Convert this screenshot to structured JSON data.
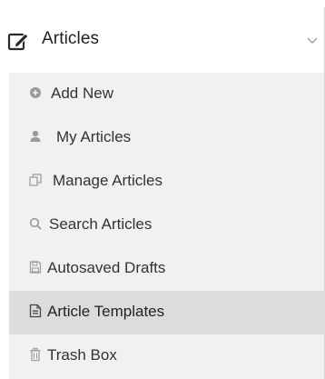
{
  "menu": {
    "title": "Articles",
    "title_icon": "edit-icon",
    "collapse_icon": "chevron-down-icon",
    "items": [
      {
        "label": "Add New",
        "icon": "plus-circle-icon",
        "active": false
      },
      {
        "label": "My Articles",
        "icon": "user-icon",
        "active": false
      },
      {
        "label": "Manage Articles",
        "icon": "copy-icon",
        "active": false
      },
      {
        "label": "Search Articles",
        "icon": "search-icon",
        "active": false
      },
      {
        "label": "Autosaved Drafts",
        "icon": "save-icon",
        "active": false
      },
      {
        "label": "Article Templates",
        "icon": "file-text-icon",
        "active": true
      },
      {
        "label": "Trash Box",
        "icon": "trash-icon",
        "active": false
      }
    ]
  },
  "colors": {
    "submenu_background": "#f1f1f1",
    "active_background": "#dcdcdc",
    "icon_gray": "#9a9a9a",
    "text": "#333333"
  }
}
